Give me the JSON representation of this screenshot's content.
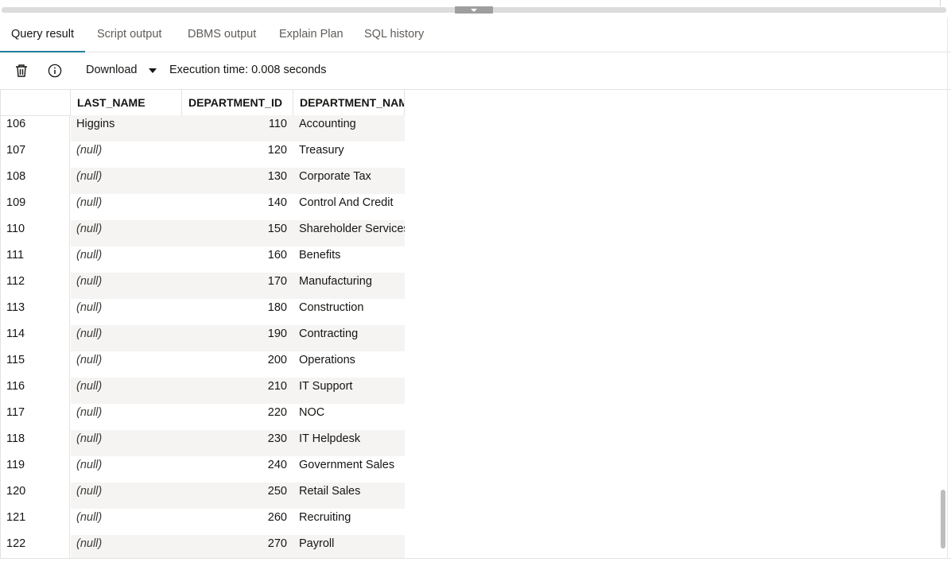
{
  "tabs": [
    {
      "label": "Query result",
      "active": true
    },
    {
      "label": "Script output",
      "active": false
    },
    {
      "label": "DBMS output",
      "active": false
    },
    {
      "label": "Explain Plan",
      "active": false
    },
    {
      "label": "SQL history",
      "active": false
    }
  ],
  "toolbar": {
    "delete_icon": "trash-icon",
    "info_icon": "info-icon",
    "download_label": "Download",
    "execution_time": "Execution time: 0.008 seconds"
  },
  "grid": {
    "columns": [
      "LAST_NAME",
      "DEPARTMENT_ID",
      "DEPARTMENT_NAM"
    ],
    "rows": [
      {
        "num": "106",
        "last_name": "Higgins",
        "department_id": "110",
        "department_name": "Accounting"
      },
      {
        "num": "107",
        "last_name": "(null)",
        "department_id": "120",
        "department_name": "Treasury"
      },
      {
        "num": "108",
        "last_name": "(null)",
        "department_id": "130",
        "department_name": "Corporate Tax"
      },
      {
        "num": "109",
        "last_name": "(null)",
        "department_id": "140",
        "department_name": "Control And Credit"
      },
      {
        "num": "110",
        "last_name": "(null)",
        "department_id": "150",
        "department_name": "Shareholder Services"
      },
      {
        "num": "111",
        "last_name": "(null)",
        "department_id": "160",
        "department_name": "Benefits"
      },
      {
        "num": "112",
        "last_name": "(null)",
        "department_id": "170",
        "department_name": "Manufacturing"
      },
      {
        "num": "113",
        "last_name": "(null)",
        "department_id": "180",
        "department_name": "Construction"
      },
      {
        "num": "114",
        "last_name": "(null)",
        "department_id": "190",
        "department_name": "Contracting"
      },
      {
        "num": "115",
        "last_name": "(null)",
        "department_id": "200",
        "department_name": "Operations"
      },
      {
        "num": "116",
        "last_name": "(null)",
        "department_id": "210",
        "department_name": "IT Support"
      },
      {
        "num": "117",
        "last_name": "(null)",
        "department_id": "220",
        "department_name": "NOC"
      },
      {
        "num": "118",
        "last_name": "(null)",
        "department_id": "230",
        "department_name": "IT Helpdesk"
      },
      {
        "num": "119",
        "last_name": "(null)",
        "department_id": "240",
        "department_name": "Government Sales"
      },
      {
        "num": "120",
        "last_name": "(null)",
        "department_id": "250",
        "department_name": "Retail Sales"
      },
      {
        "num": "121",
        "last_name": "(null)",
        "department_id": "260",
        "department_name": "Recruiting"
      },
      {
        "num": "122",
        "last_name": "(null)",
        "department_id": "270",
        "department_name": "Payroll"
      }
    ]
  },
  "colors": {
    "accent": "#227e9e",
    "row_band": "#f5f4f2",
    "border": "#e3e3e3"
  }
}
